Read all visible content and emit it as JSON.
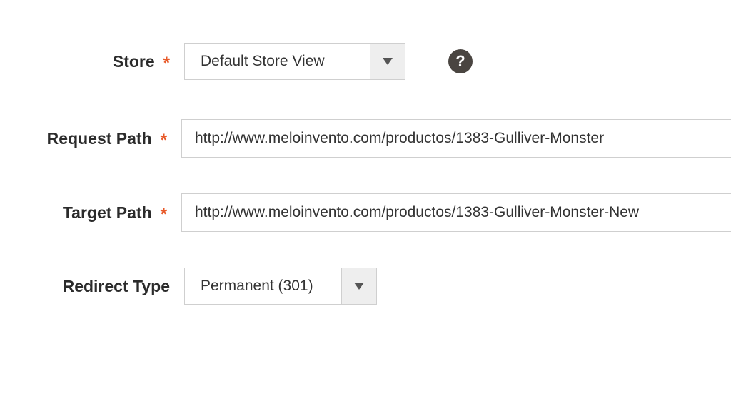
{
  "labels": {
    "store": "Store",
    "request_path": "Request Path",
    "target_path": "Target Path",
    "redirect_type": "Redirect Type"
  },
  "fields": {
    "store_value": "Default Store View",
    "request_path_value": "http://www.meloinvento.com/productos/1383-Gulliver-Monster",
    "target_path_value": "http://www.meloinvento.com/productos/1383-Gulliver-Monster-New",
    "redirect_type_value": "Permanent (301)"
  },
  "required": {
    "store": true,
    "request_path": true,
    "target_path": true,
    "redirect_type": false
  },
  "icons": {
    "help": "?"
  }
}
